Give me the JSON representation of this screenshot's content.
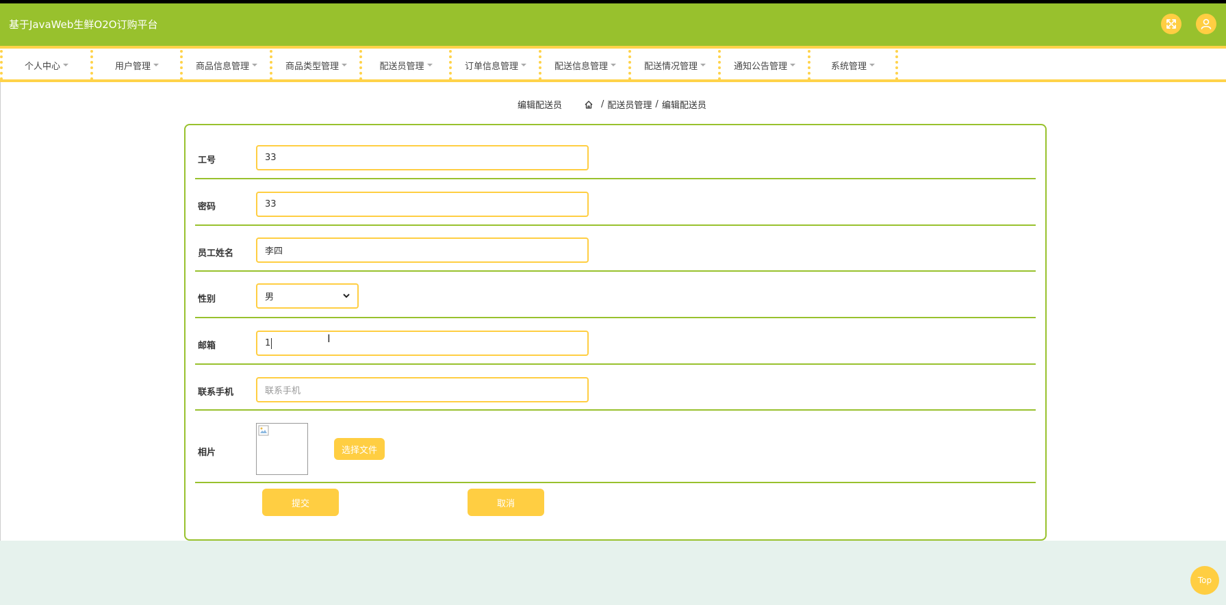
{
  "app": {
    "title": "基于JavaWeb生鲜O2O订购平台"
  },
  "header": {
    "fullscreen_icon": "expand-icon",
    "user_icon": "user-icon"
  },
  "nav": {
    "items": [
      {
        "label": "个人中心"
      },
      {
        "label": "用户管理"
      },
      {
        "label": "商品信息管理"
      },
      {
        "label": "商品类型管理"
      },
      {
        "label": "配送员管理"
      },
      {
        "label": "订单信息管理"
      },
      {
        "label": "配送信息管理"
      },
      {
        "label": "配送情况管理"
      },
      {
        "label": "通知公告管理"
      },
      {
        "label": "系统管理"
      }
    ]
  },
  "breadcrumb": {
    "page_title": "编辑配送员",
    "sep": "/",
    "level1": "配送员管理",
    "level2": "编辑配送员"
  },
  "form": {
    "fields": {
      "employee_id": {
        "label": "工号",
        "value": "33"
      },
      "password": {
        "label": "密码",
        "value": "33"
      },
      "name": {
        "label": "员工姓名",
        "value": "李四"
      },
      "gender": {
        "label": "性别",
        "value": "男"
      },
      "email": {
        "label": "邮箱",
        "value": "1"
      },
      "phone": {
        "label": "联系手机",
        "value": "",
        "placeholder": "联系手机"
      },
      "photo": {
        "label": "相片",
        "button": "选择文件"
      }
    },
    "submit_label": "提交",
    "cancel_label": "取消"
  },
  "back_to_top": "Top",
  "colors": {
    "primary_green": "#98c12d",
    "accent_yellow": "#ffce42",
    "page_bg": "#e6f2ed"
  }
}
